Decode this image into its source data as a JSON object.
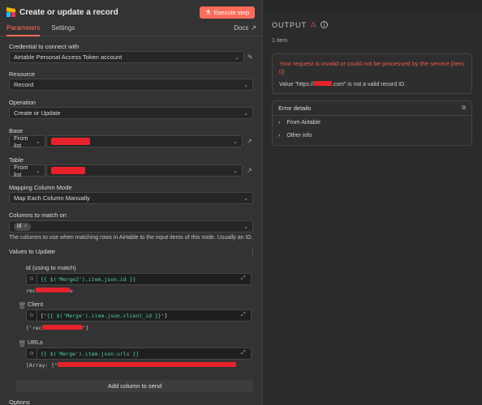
{
  "header": {
    "title": "Create or update a record",
    "execute_label": "Execute step"
  },
  "tabs": {
    "parameters": "Parameters",
    "settings": "Settings",
    "docs": "Docs"
  },
  "fields": {
    "credential": {
      "label": "Credential to connect with",
      "value": "Airtable Personal Access Token account"
    },
    "resource": {
      "label": "Resource",
      "value": "Record"
    },
    "operation": {
      "label": "Operation",
      "value": "Create or Update"
    },
    "base": {
      "label": "Base",
      "mode": "From list"
    },
    "table": {
      "label": "Table",
      "mode": "From list"
    },
    "mapping": {
      "label": "Mapping Column Mode",
      "value": "Map Each Column Manually"
    },
    "match": {
      "label": "Columns to match on",
      "chip": "id",
      "hint": "The columns to use when matching rows in Airtable to the input items of this node. Usually an ID."
    }
  },
  "values": {
    "header": "Values to Update",
    "rows": [
      {
        "label": "id (using to match)",
        "expr": "{{ $('Merge2').item.json.id }}",
        "result_prefix": "rec",
        "result_suffix": "u"
      },
      {
        "label": "Client",
        "expr_pre": "['",
        "expr": "{{ $('Merge').item.json.client_id }}",
        "expr_post": "']",
        "result_prefix": "['rec",
        "result_suffix": "']"
      },
      {
        "label": "URLs",
        "expr": "{{ $('Merge').item.json.urls }}",
        "result_prefix": "[Array: [\""
      }
    ],
    "add_column": "Add column to send",
    "options": "Options"
  },
  "output": {
    "title": "OUTPUT",
    "count": "1 item",
    "error_msg": "Your request is invalid or could not be processed by the service [item 0]",
    "error_sub_pre": "Value \"https://",
    "error_sub_post": ".com\" is not a valid record ID.",
    "details_title": "Error details",
    "details_items": [
      "From Airtable",
      "Other info"
    ]
  },
  "colors": {
    "accent": "#ff6d5a",
    "error": "#f05a4a",
    "code": "#4fd09c",
    "redaction": "#e8222d"
  }
}
